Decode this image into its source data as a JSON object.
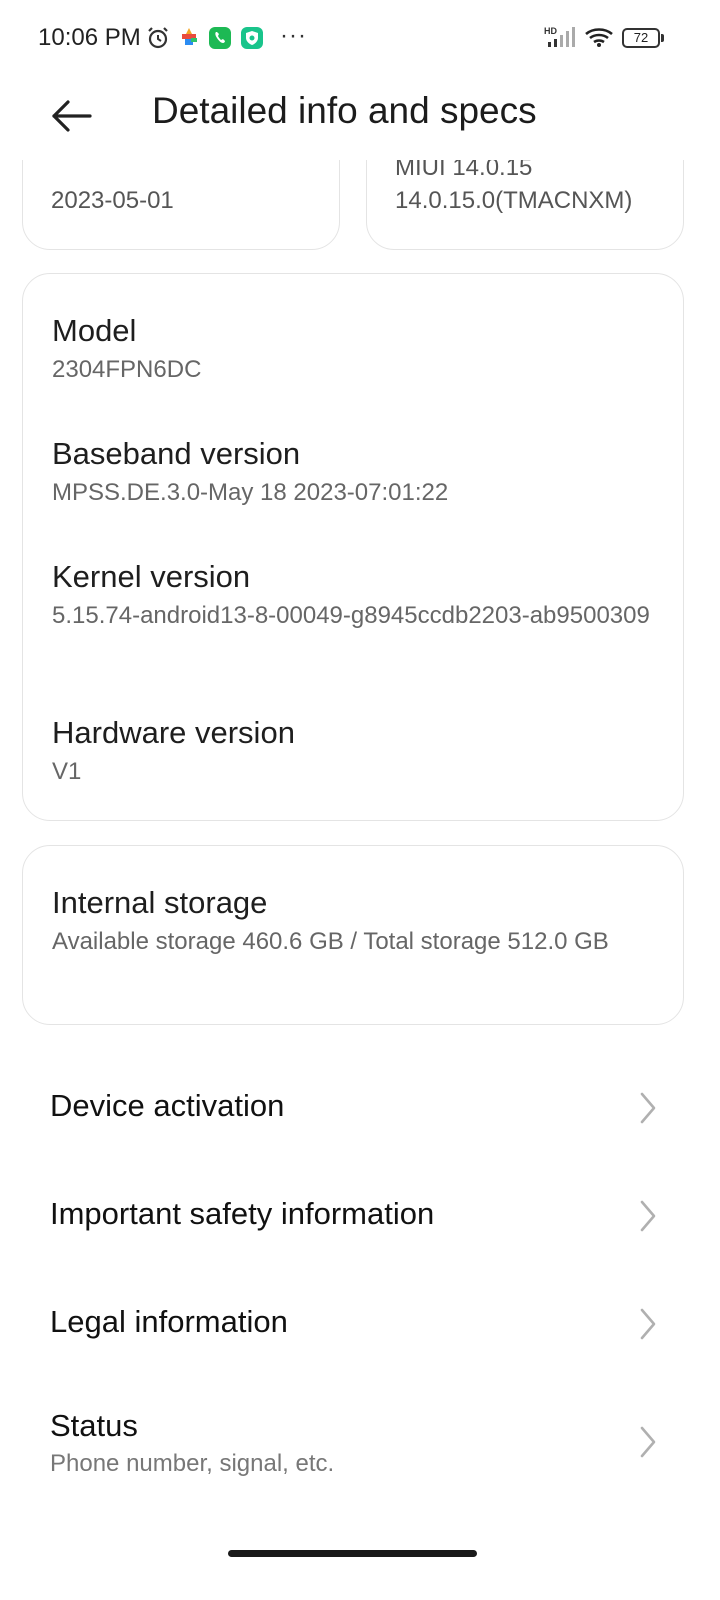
{
  "status_bar": {
    "time": "10:06 PM",
    "battery": "72",
    "network_badge": "HD",
    "more": "···",
    "icons": [
      "alarm-icon",
      "app-notification-icon",
      "phone-app-icon",
      "security-app-icon",
      "signal-icon",
      "wifi-icon",
      "battery-icon"
    ]
  },
  "header": {
    "title": "Detailed info and specs",
    "back_icon": "arrow-left-icon"
  },
  "top_cards": {
    "left_value": "2023-05-01",
    "right_line1": "MIUI 14.0.15",
    "right_line2": "14.0.15.0(TMACNXM)"
  },
  "specs": {
    "model_label": "Model",
    "model_value": "2304FPN6DC",
    "baseband_label": "Baseband version",
    "baseband_value": "MPSS.DE.3.0-May 18 2023-07:01:22",
    "kernel_label": "Kernel version",
    "kernel_value": "5.15.74-android13-8-00049-g8945ccdb2203-ab9500309",
    "hardware_label": "Hardware version",
    "hardware_value": "V1"
  },
  "storage": {
    "title": "Internal storage",
    "detail": "Available storage  460.6 GB / Total storage  512.0 GB"
  },
  "nav": [
    {
      "label": "Device activation"
    },
    {
      "label": "Important safety information"
    },
    {
      "label": "Legal information"
    },
    {
      "label": "Status",
      "sub": "Phone number, signal, etc."
    }
  ],
  "colors": {
    "card_border": "#e4e4e4",
    "secondary_text": "#666666",
    "chevron": "#b0b0b0",
    "app_green": "#1db954"
  }
}
